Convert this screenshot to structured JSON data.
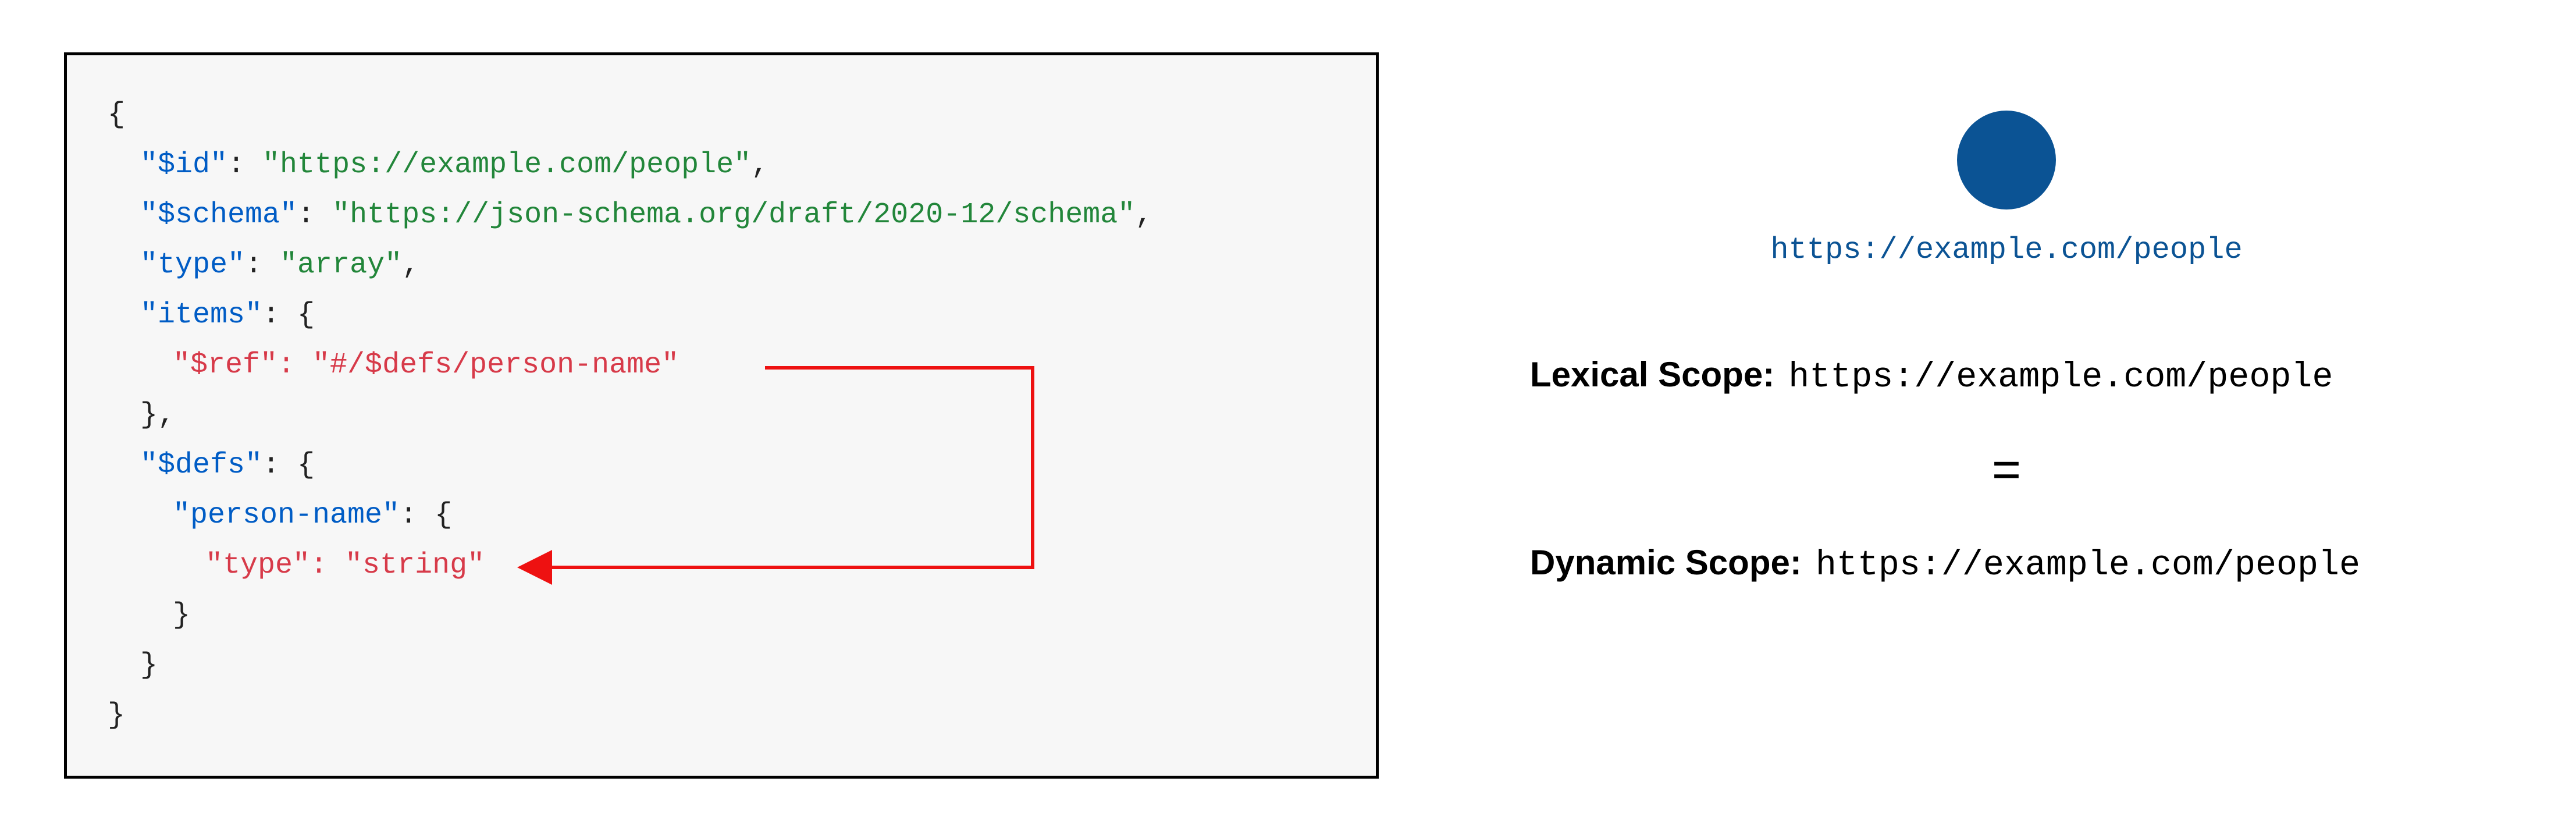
{
  "code": {
    "id_key": "\"$id\"",
    "id_val": "\"https://example.com/people\"",
    "schema_key": "\"$schema\"",
    "schema_val": "\"https://json-schema.org/draft/2020-12/schema\"",
    "type_key": "\"type\"",
    "type_val": "\"array\"",
    "items_key": "\"items\"",
    "ref_key": "\"$ref\"",
    "ref_val": "\"#/$defs/person-name\"",
    "defs_key": "\"$defs\"",
    "person_key": "\"person-name\"",
    "inner_type_key": "\"type\"",
    "inner_type_val": "\"string\""
  },
  "diagram": {
    "node_label": "https://example.com/people",
    "lexical_label": "Lexical Scope:",
    "lexical_value": "https://example.com/people",
    "dynamic_label": "Dynamic Scope:",
    "dynamic_value": "https://example.com/people",
    "equals": "="
  },
  "colors": {
    "brand_blue": "#0b5394",
    "code_key_blue": "#005cc5",
    "code_str_green": "#22863a",
    "code_highlight_red": "#d73a49"
  }
}
